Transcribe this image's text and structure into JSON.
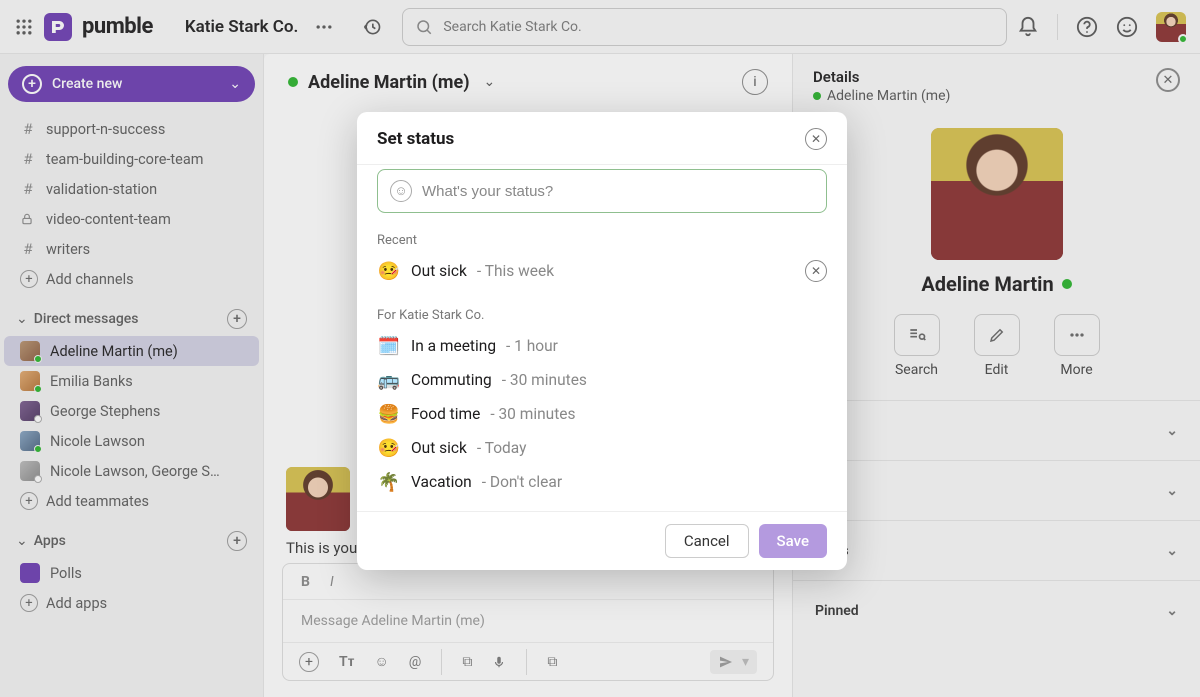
{
  "brand": {
    "name": "pumble"
  },
  "workspace": {
    "name": "Katie Stark Co."
  },
  "search": {
    "placeholder": "Search Katie Stark Co."
  },
  "sidebar": {
    "create_label": "Create new",
    "channels": [
      {
        "prefix": "#",
        "name": "support-n-success"
      },
      {
        "prefix": "#",
        "name": "team-building-core-team"
      },
      {
        "prefix": "#",
        "name": "validation-station"
      },
      {
        "prefix": "lock",
        "name": "video-content-team"
      },
      {
        "prefix": "#",
        "name": "writers"
      }
    ],
    "add_channels": "Add channels",
    "dm_header": "Direct messages",
    "dms": [
      {
        "name": "Adeline Martin (me)",
        "online": true,
        "selected": true
      },
      {
        "name": "Emilia Banks",
        "online": true
      },
      {
        "name": "George Stephens",
        "online": false
      },
      {
        "name": "Nicole Lawson",
        "online": true
      },
      {
        "name": "Nicole Lawson, George Ste…",
        "online": false
      }
    ],
    "add_teammates": "Add teammates",
    "apps_header": "Apps",
    "apps": [
      {
        "name": "Polls"
      }
    ],
    "add_apps": "Add apps"
  },
  "main": {
    "title": "Adeline Martin (me)",
    "intro_text": "This is your",
    "composer_placeholder": "Message Adeline Martin (me)"
  },
  "details": {
    "title": "Details",
    "subtitle": "Adeline Martin (me)",
    "display_name": "Adeline Martin",
    "actions": {
      "search": "Search",
      "edit": "Edit",
      "more": "More"
    },
    "sections": {
      "links": "Links",
      "pinned": "Pinned"
    }
  },
  "modal": {
    "title": "Set status",
    "placeholder": "What's your status?",
    "recent_label": "Recent",
    "org_label": "For Katie Stark Co.",
    "recent": [
      {
        "emoji": "🤒",
        "text": "Out sick",
        "duration": "This week"
      }
    ],
    "suggestions": [
      {
        "emoji": "🗓️",
        "text": "In a meeting",
        "duration": "1 hour"
      },
      {
        "emoji": "🚌",
        "text": "Commuting",
        "duration": "30 minutes"
      },
      {
        "emoji": "🍔",
        "text": "Food time",
        "duration": "30 minutes"
      },
      {
        "emoji": "🤒",
        "text": "Out sick",
        "duration": "Today"
      },
      {
        "emoji": "🌴",
        "text": "Vacation",
        "duration": "Don't clear"
      }
    ],
    "cancel": "Cancel",
    "save": "Save"
  }
}
